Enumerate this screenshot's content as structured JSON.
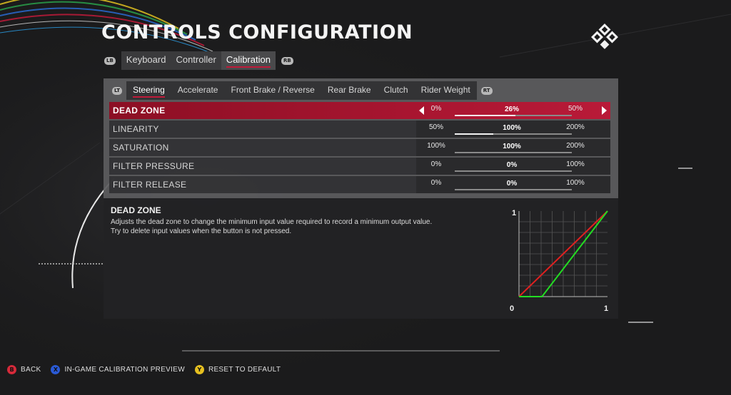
{
  "title": "CONTROLS CONFIGURATION",
  "top_tabs": {
    "left_bumper": "LB",
    "right_bumper": "RB",
    "items": [
      "Keyboard",
      "Controller",
      "Calibration"
    ],
    "active_index": 2
  },
  "sub_tabs": {
    "left_trigger": "LT",
    "right_trigger": "RT",
    "items": [
      "Steering",
      "Accelerate",
      "Front Brake / Reverse",
      "Rear Brake",
      "Clutch",
      "Rider Weight"
    ],
    "active_index": 0
  },
  "settings": [
    {
      "label": "DEAD ZONE",
      "min": "0%",
      "value": "26%",
      "max": "50%",
      "level": 0.52,
      "selected": true
    },
    {
      "label": "LINEARITY",
      "min": "50%",
      "value": "100%",
      "max": "200%",
      "level": 0.33,
      "selected": false
    },
    {
      "label": "SATURATION",
      "min": "100%",
      "value": "100%",
      "max": "200%",
      "level": 0.0,
      "selected": false
    },
    {
      "label": "FILTER PRESSURE",
      "min": "0%",
      "value": "0%",
      "max": "100%",
      "level": 0.0,
      "selected": false
    },
    {
      "label": "FILTER RELEASE",
      "min": "0%",
      "value": "0%",
      "max": "100%",
      "level": 0.0,
      "selected": false
    }
  ],
  "description": {
    "title": "DEAD ZONE",
    "line1": "Adjusts the dead zone to change the minimum input value required to record a minimum output value.",
    "line2": "Try to delete input values when the button is not pressed."
  },
  "graph": {
    "y_max_label": "1",
    "x_min_label": "0",
    "x_max_label": "1",
    "reference_color": "#e02020",
    "curve_color": "#22dd22",
    "curve_dead_zone": 0.26
  },
  "footer": [
    {
      "button": "B",
      "label": "BACK",
      "color": "#d62a3a"
    },
    {
      "button": "X",
      "label": "IN-GAME CALIBRATION PREVIEW",
      "color": "#2a5ad6"
    },
    {
      "button": "Y",
      "label": "RESET TO DEFAULT",
      "color": "#e6c020"
    }
  ],
  "colors": {
    "accent": "#c01a3a"
  }
}
